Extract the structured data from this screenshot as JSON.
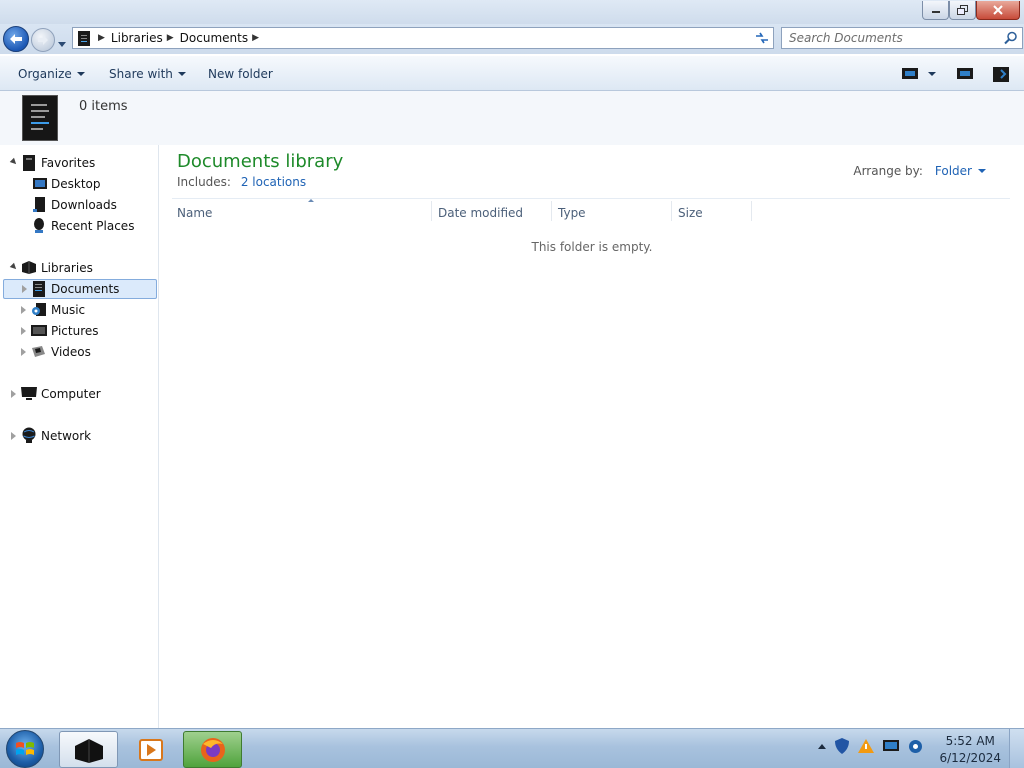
{
  "window": {
    "buttons": {
      "minimize": "minimize",
      "maximize": "restore",
      "close": "close"
    }
  },
  "address": {
    "segments": [
      "Libraries",
      "Documents"
    ],
    "search_placeholder": "Search Documents"
  },
  "toolbar": {
    "organize": "Organize",
    "share_with": "Share with",
    "new_folder": "New folder"
  },
  "details": {
    "item_count": "0 items"
  },
  "nav": {
    "favorites": {
      "label": "Favorites",
      "items": [
        "Desktop",
        "Downloads",
        "Recent Places"
      ]
    },
    "libraries": {
      "label": "Libraries",
      "items": [
        "Documents",
        "Music",
        "Pictures",
        "Videos"
      ],
      "selected": "Documents"
    },
    "computer": "Computer",
    "network": "Network"
  },
  "content": {
    "title": "Documents library",
    "includes_label": "Includes:",
    "includes_link": "2 locations",
    "arrange_label": "Arrange by:",
    "arrange_value": "Folder",
    "columns": [
      "Name",
      "Date modified",
      "Type",
      "Size"
    ],
    "empty_message": "This folder is empty."
  },
  "taskbar": {
    "time": "5:52 AM",
    "date": "6/12/2024"
  },
  "colors": {
    "accent_title": "#1e8a2a",
    "link": "#1f63b5",
    "selected_bg": "#dbeafb"
  }
}
